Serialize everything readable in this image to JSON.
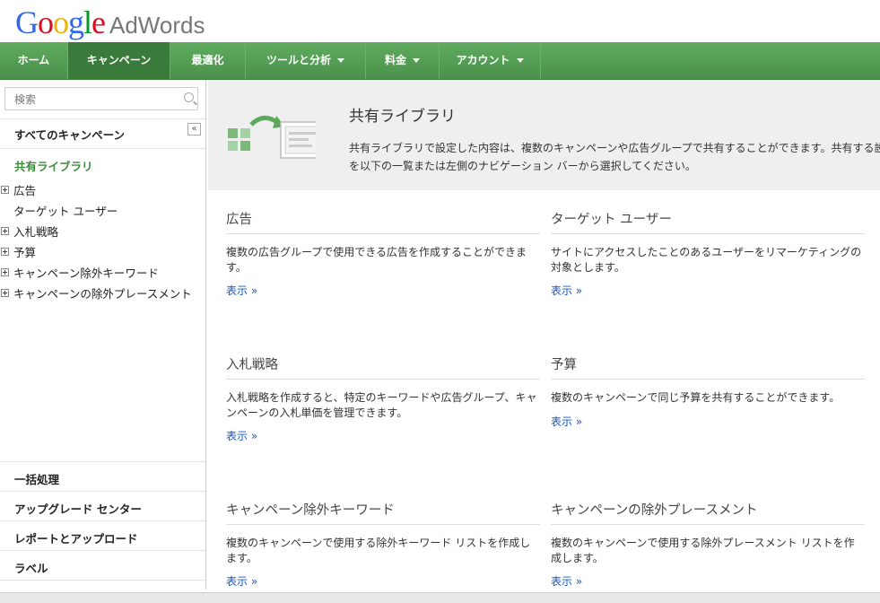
{
  "logo": {
    "google": "Google",
    "product": "AdWords"
  },
  "nav": {
    "items": [
      {
        "label": "ホーム",
        "dropdown": false
      },
      {
        "label": "キャンペーン",
        "dropdown": false,
        "active": true
      },
      {
        "label": "最適化",
        "dropdown": false
      },
      {
        "label": "ツールと分析",
        "dropdown": true
      },
      {
        "label": "料金",
        "dropdown": true
      },
      {
        "label": "アカウント",
        "dropdown": true
      }
    ]
  },
  "sidebar": {
    "search_placeholder": "検索",
    "all_campaigns": "すべてのキャンペーン",
    "collapse_glyph": "«",
    "shared_library": "共有ライブラリ",
    "tree": [
      {
        "label": "広告",
        "expandable": true
      },
      {
        "label": "ターゲット ユーザー",
        "expandable": false
      },
      {
        "label": "入札戦略",
        "expandable": true
      },
      {
        "label": "予算",
        "expandable": true
      },
      {
        "label": "キャンペーン除外キーワード",
        "expandable": true
      },
      {
        "label": "キャンペーンの除外プレースメント",
        "expandable": true
      }
    ],
    "bottom": [
      "一括処理",
      "アップグレード センター",
      "レポートとアップロード",
      "ラベル"
    ]
  },
  "banner": {
    "title": "共有ライブラリ",
    "desc_line1": "共有ライブラリで設定した内容は、複数のキャンペーンや広告グループで共有することができます。共有する設",
    "desc_line2": "を以下の一覧または左側のナビゲーション バーから選択してください。"
  },
  "cards": [
    {
      "title": "広告",
      "desc": "複数の広告グループで使用できる広告を作成することができます。",
      "link": "表示 »"
    },
    {
      "title": "ターゲット ユーザー",
      "desc": "サイトにアクセスしたことのあるユーザーをリマーケティングの対象とします。",
      "link": "表示 »"
    },
    {
      "title": "入札戦略",
      "desc": "入札戦略を作成すると、特定のキーワードや広告グループ、キャンペーンの入札単価を管理できます。",
      "link": "表示 »"
    },
    {
      "title": "予算",
      "desc": "複数のキャンペーンで同じ予算を共有することができます。",
      "link": "表示 »"
    },
    {
      "title": "キャンペーン除外キーワード",
      "desc": "複数のキャンペーンで使用する除外キーワード リストを作成します。",
      "link": "表示 »"
    },
    {
      "title": "キャンペーンの除外プレースメント",
      "desc": "複数のキャンペーンで使用する除外プレースメント リストを作成します。",
      "link": "表示 »"
    }
  ],
  "colors": {
    "nav_green": "#519951",
    "active_green": "#3a7a3a",
    "link_blue": "#1155cc",
    "shared_green": "#3c8a3c"
  }
}
